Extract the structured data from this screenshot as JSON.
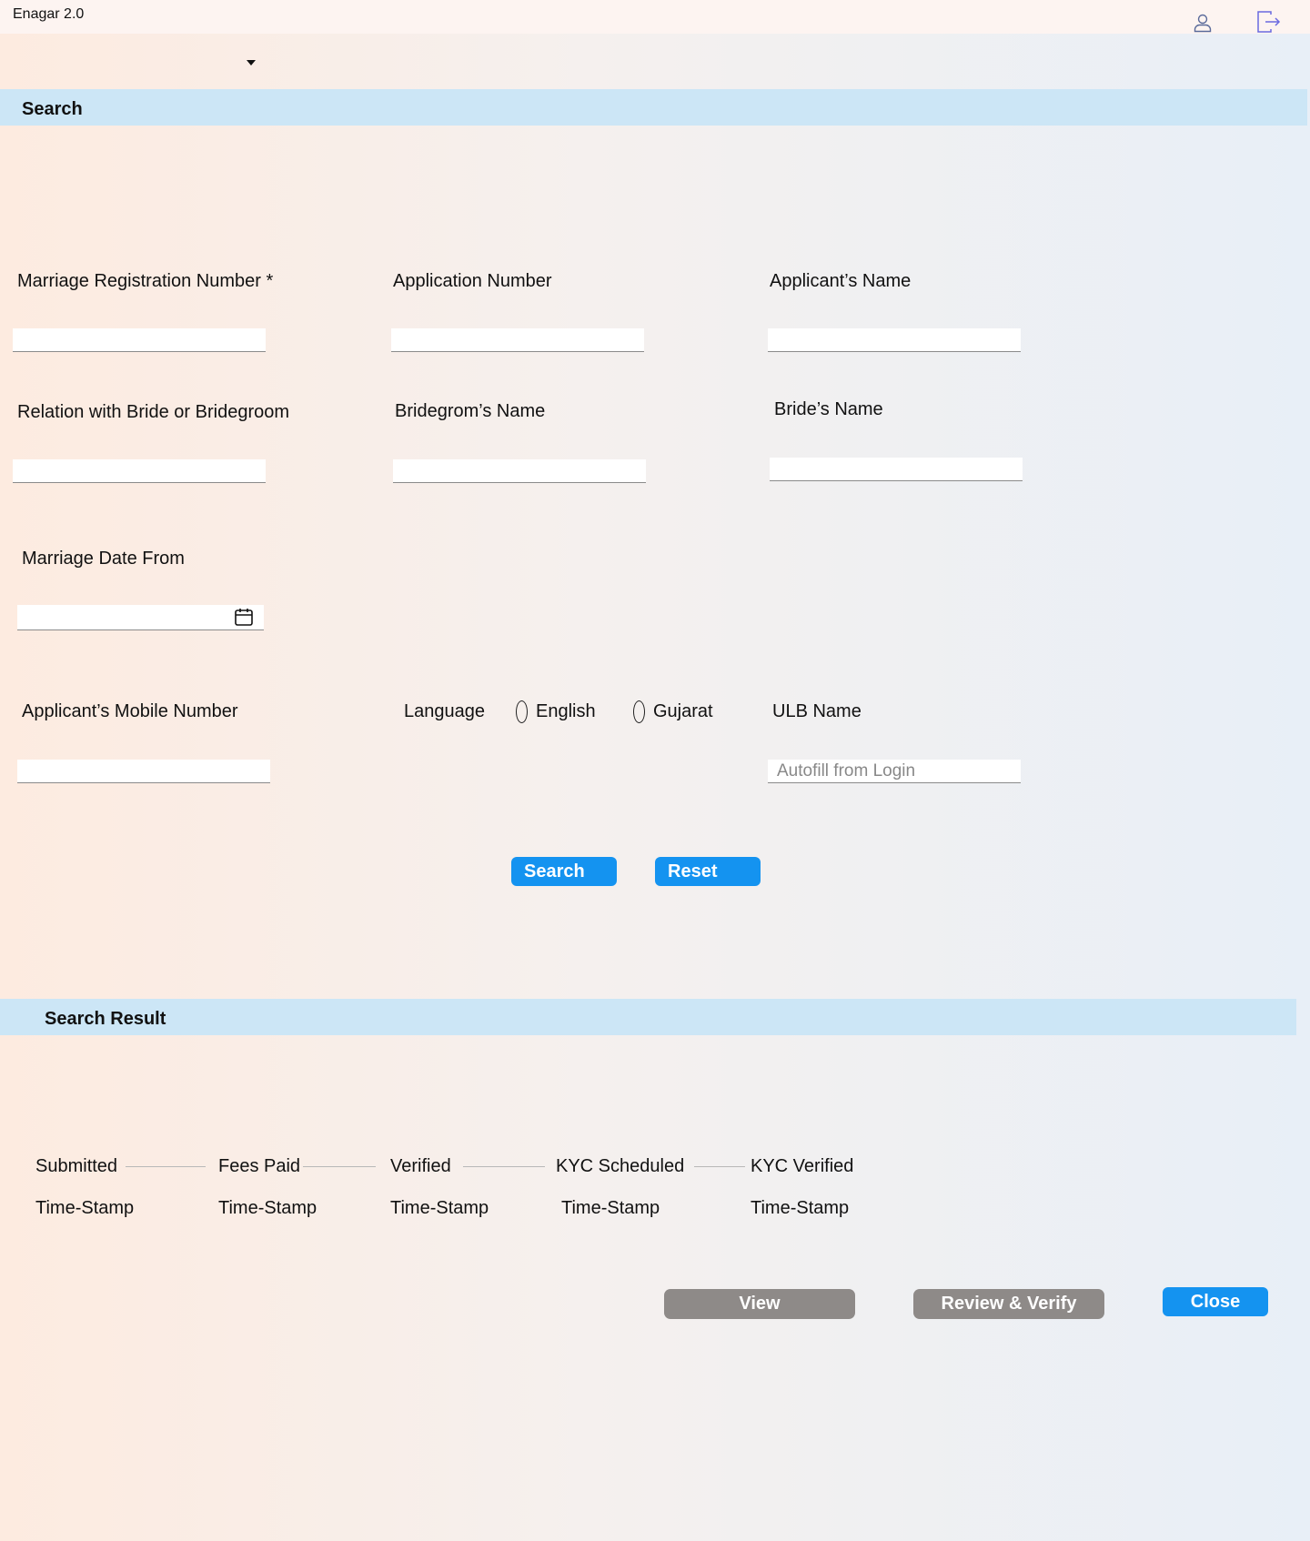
{
  "app": {
    "title": "Enagar 2.0"
  },
  "header": {
    "user_icon": "user-icon",
    "logout_icon": "logout-icon"
  },
  "search_section": {
    "title": "Search",
    "fields": {
      "marriage_registration_number": {
        "label": "Marriage Registration Number *",
        "value": ""
      },
      "application_number": {
        "label": "Application Number",
        "value": ""
      },
      "applicants_name": {
        "label": "Applicant’s Name",
        "value": ""
      },
      "relation": {
        "label": "Relation with Bride or Bridegroom",
        "value": ""
      },
      "bridegroom_name": {
        "label": "Bridegrom’s Name",
        "value": ""
      },
      "bride_name": {
        "label": "Bride’s Name",
        "value": ""
      },
      "marriage_date_from": {
        "label": "Marriage Date From",
        "value": ""
      },
      "mobile_number": {
        "label": "Applicant’s Mobile Number",
        "value": ""
      },
      "language": {
        "label": "Language",
        "options": [
          "English",
          "Gujarat"
        ]
      },
      "ulb_name": {
        "label": "ULB Name",
        "placeholder": "Autofill from Login"
      }
    },
    "buttons": {
      "search": "Search",
      "reset": "Reset"
    }
  },
  "result_section": {
    "title": "Search Result",
    "timeline": [
      {
        "status": "Submitted",
        "time": "Time-Stamp"
      },
      {
        "status": "Fees Paid",
        "time": "Time-Stamp"
      },
      {
        "status": "Verified",
        "time": "Time-Stamp"
      },
      {
        "status": "KYC Scheduled",
        "time": "Time-Stamp"
      },
      {
        "status": "KYC Verified",
        "time": "Time-Stamp"
      }
    ],
    "buttons": {
      "view": "View",
      "review_verify": "Review & Verify",
      "close": "Close"
    }
  },
  "colors": {
    "section_bar": "#cce6f6",
    "primary_button": "#1493f0",
    "secondary_button": "#8e8a88"
  }
}
